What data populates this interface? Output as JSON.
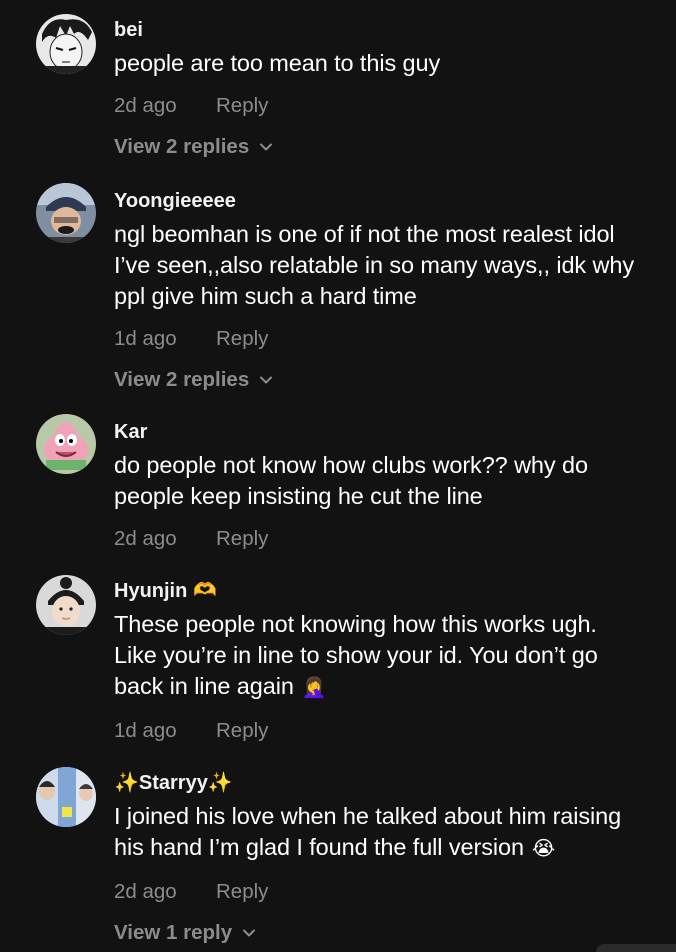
{
  "comments": [
    {
      "username": "bei",
      "username_emoji": "",
      "lines": [
        "people are too mean to this guy"
      ],
      "time": "2d ago",
      "reply_label": "Reply",
      "view_replies": "View 2 replies",
      "avatar_icon": "avatar-manga-boy"
    },
    {
      "username": "Yoongieeeee",
      "username_emoji": "",
      "lines": [
        "ngl beomhan is one of if not the most realest idol",
        "I’ve seen,,also relatable in so many ways,, idk why",
        "ppl give him such a hard time"
      ],
      "time": "1d ago",
      "reply_label": "Reply",
      "view_replies": "View 2 replies",
      "avatar_icon": "avatar-person-cap"
    },
    {
      "username": "Kar",
      "username_emoji": "",
      "lines": [
        "do people not know how clubs work?? why do",
        "people keep insisting he cut the line"
      ],
      "time": "2d ago",
      "reply_label": "Reply",
      "view_replies": "",
      "avatar_icon": "avatar-cartoon-star"
    },
    {
      "username": "Hyunjin",
      "username_emoji": "🫶",
      "lines": [
        "These people not knowing how this works ugh.",
        "Like you’re in line to show your id. You don’t go",
        "back in line again"
      ],
      "last_line_emoji": "🤦‍♀️",
      "time": "1d ago",
      "reply_label": "Reply",
      "view_replies": "",
      "avatar_icon": "avatar-person-beanie"
    },
    {
      "username": "✨Starryy✨",
      "username_emoji": "",
      "lines": [
        "I joined his love when he talked about him raising",
        "his hand I’m glad I found the full version"
      ],
      "last_line_emoji": "😭",
      "time": "2d ago",
      "reply_label": "Reply",
      "view_replies": "View 1 reply",
      "avatar_icon": "avatar-collage"
    }
  ],
  "colors": {
    "background": "#121212",
    "text": "#ffffff",
    "muted": "#8c8c8c"
  }
}
